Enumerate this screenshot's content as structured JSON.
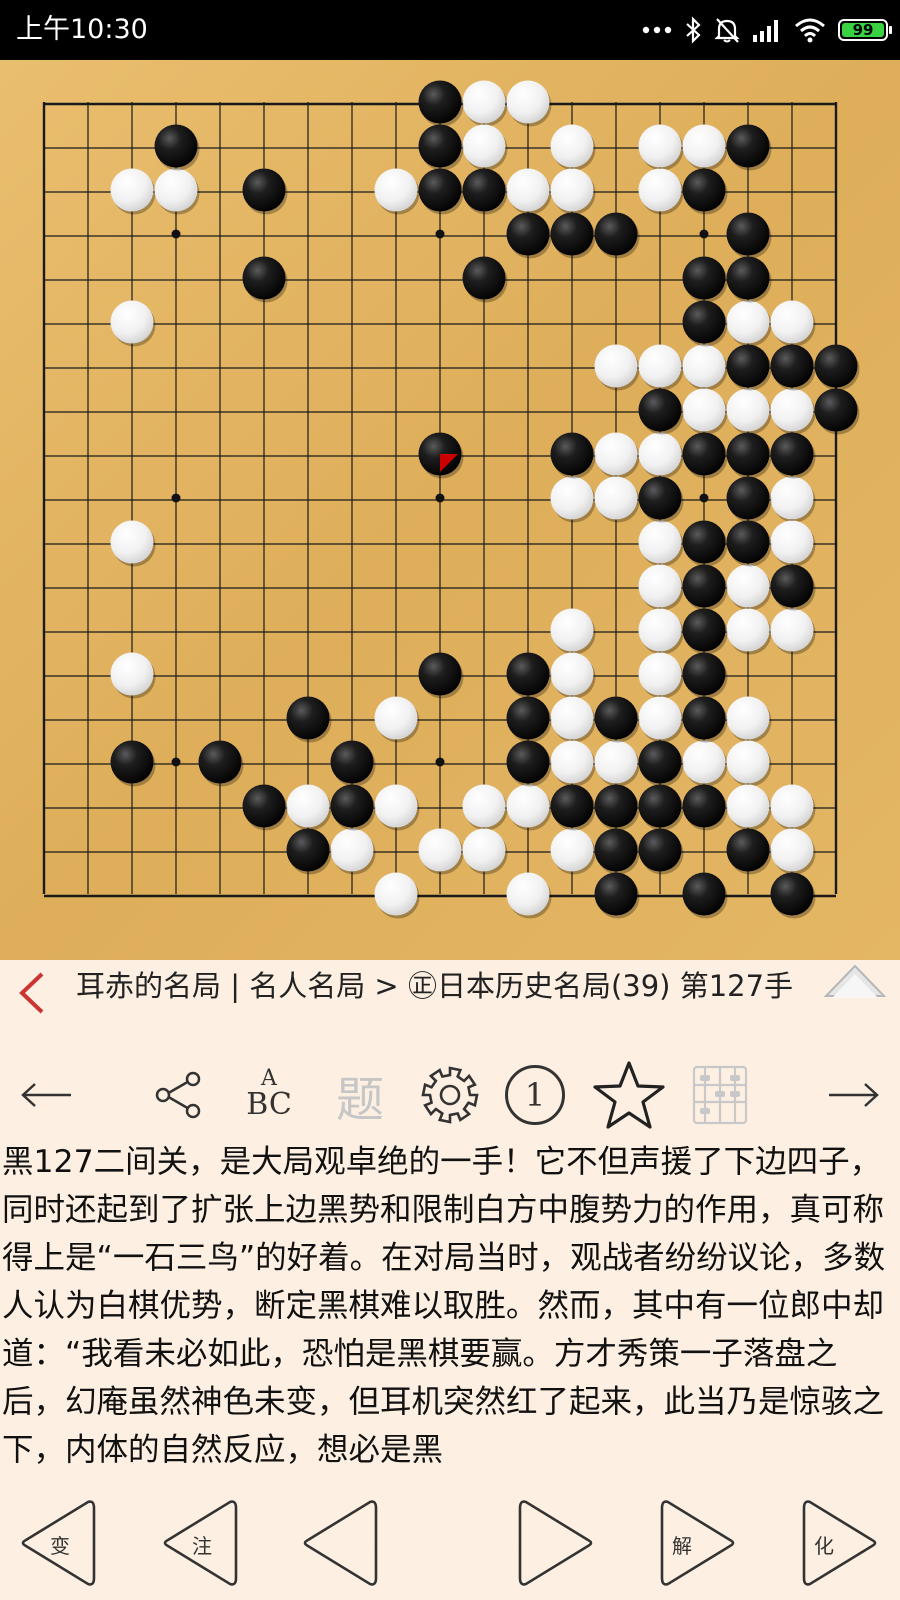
{
  "status_bar": {
    "time": "上午10:30",
    "battery": "99",
    "icons": [
      "more-dots-icon",
      "bluetooth-icon",
      "mute-bell-icon",
      "signal-icon",
      "wifi-icon",
      "battery-icon"
    ]
  },
  "board": {
    "size": 19,
    "wood_color": "#e2b35f",
    "stones": {
      "black": [
        [
          9,
          0
        ],
        [
          3,
          1
        ],
        [
          9,
          1
        ],
        [
          16,
          1
        ],
        [
          5,
          2
        ],
        [
          9,
          2
        ],
        [
          10,
          2
        ],
        [
          15,
          2
        ],
        [
          11,
          3
        ],
        [
          12,
          3
        ],
        [
          13,
          3
        ],
        [
          16,
          3
        ],
        [
          5,
          4
        ],
        [
          10,
          4
        ],
        [
          15,
          4
        ],
        [
          16,
          4
        ],
        [
          15,
          5
        ],
        [
          16,
          6
        ],
        [
          17,
          6
        ],
        [
          18,
          6
        ],
        [
          14,
          7
        ],
        [
          18,
          7
        ],
        [
          9,
          8
        ],
        [
          12,
          8
        ],
        [
          15,
          8
        ],
        [
          16,
          8
        ],
        [
          17,
          8
        ],
        [
          14,
          9
        ],
        [
          16,
          9
        ],
        [
          15,
          10
        ],
        [
          16,
          10
        ],
        [
          15,
          11
        ],
        [
          17,
          11
        ],
        [
          15,
          12
        ],
        [
          9,
          13
        ],
        [
          11,
          13
        ],
        [
          15,
          13
        ],
        [
          6,
          14
        ],
        [
          11,
          14
        ],
        [
          13,
          14
        ],
        [
          15,
          14
        ],
        [
          2,
          15
        ],
        [
          4,
          15
        ],
        [
          7,
          15
        ],
        [
          11,
          15
        ],
        [
          14,
          15
        ],
        [
          5,
          16
        ],
        [
          7,
          16
        ],
        [
          12,
          16
        ],
        [
          13,
          16
        ],
        [
          14,
          16
        ],
        [
          15,
          16
        ],
        [
          6,
          17
        ],
        [
          13,
          17
        ],
        [
          14,
          17
        ],
        [
          16,
          17
        ],
        [
          13,
          18
        ],
        [
          15,
          18
        ],
        [
          17,
          18
        ]
      ],
      "white": [
        [
          10,
          0
        ],
        [
          11,
          0
        ],
        [
          10,
          1
        ],
        [
          12,
          1
        ],
        [
          14,
          1
        ],
        [
          15,
          1
        ],
        [
          2,
          2
        ],
        [
          3,
          2
        ],
        [
          8,
          2
        ],
        [
          11,
          2
        ],
        [
          12,
          2
        ],
        [
          14,
          2
        ],
        [
          2,
          5
        ],
        [
          16,
          5
        ],
        [
          17,
          5
        ],
        [
          13,
          6
        ],
        [
          14,
          6
        ],
        [
          15,
          6
        ],
        [
          15,
          7
        ],
        [
          16,
          7
        ],
        [
          17,
          7
        ],
        [
          13,
          8
        ],
        [
          14,
          8
        ],
        [
          12,
          9
        ],
        [
          13,
          9
        ],
        [
          17,
          9
        ],
        [
          2,
          10
        ],
        [
          14,
          10
        ],
        [
          17,
          10
        ],
        [
          14,
          11
        ],
        [
          16,
          11
        ],
        [
          12,
          12
        ],
        [
          14,
          12
        ],
        [
          16,
          12
        ],
        [
          17,
          12
        ],
        [
          2,
          13
        ],
        [
          12,
          13
        ],
        [
          14,
          13
        ],
        [
          8,
          14
        ],
        [
          12,
          14
        ],
        [
          14,
          14
        ],
        [
          16,
          14
        ],
        [
          12,
          15
        ],
        [
          13,
          15
        ],
        [
          15,
          15
        ],
        [
          16,
          15
        ],
        [
          6,
          16
        ],
        [
          8,
          16
        ],
        [
          10,
          16
        ],
        [
          11,
          16
        ],
        [
          16,
          16
        ],
        [
          17,
          16
        ],
        [
          7,
          17
        ],
        [
          9,
          17
        ],
        [
          10,
          17
        ],
        [
          12,
          17
        ],
        [
          17,
          17
        ],
        [
          8,
          18
        ],
        [
          11,
          18
        ]
      ]
    },
    "last_move": [
      9,
      8
    ],
    "last_move_color": "#cc0000"
  },
  "header": {
    "title": "耳赤的名局 | 名人名局 > ㊣日本历史名局(39) 第127手",
    "back_icon": "chevron-left-icon",
    "collapse_icon": "triangle-up-icon",
    "accent": "#cc3333"
  },
  "toolbar": {
    "prev_icon": "arrow-left-icon",
    "share_icon": "share-icon",
    "abc_line1": "A",
    "abc_line2": "BC",
    "problem_label": "题",
    "settings_icon": "gear-icon",
    "move_number_label": "1",
    "favorite_icon": "star-icon",
    "abacus_icon": "abacus-icon",
    "next_icon": "arrow-right-icon"
  },
  "commentary": {
    "text": "黑127二间关，是大局观卓绝的一手！它不但声援了下边四子，同时还起到了扩张上边黑势和限制白方中腹势力的作用，真可称得上是“一石三鸟”的好着。在对局当时，观战者纷纷议论，多数人认为白棋优势，断定黑棋难以取胜。然而，其中有一位郎中却道：“我看未必如此，恐怕是黑棋要赢。方才秀策一子落盘之后，幻庵虽然神色未变，但耳机突然红了起来，此当乃是惊骇之下，内体的自然反应，想必是黑"
  },
  "bottom_nav": {
    "variation_label": "变",
    "comment_label": "注",
    "solve_label": "解",
    "simplify_label": "化"
  }
}
